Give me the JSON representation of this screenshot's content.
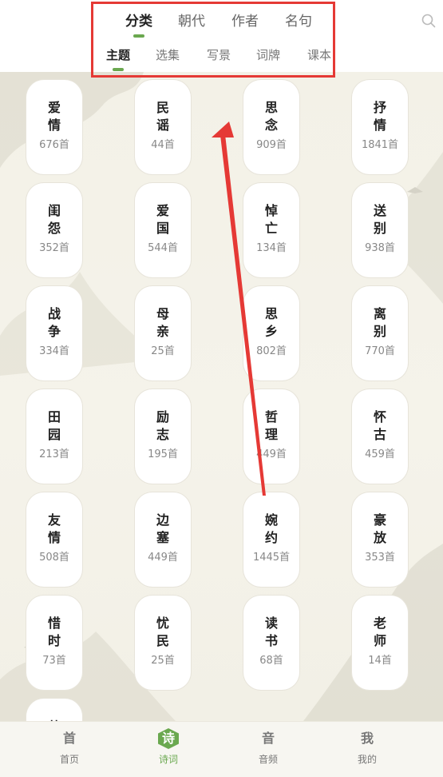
{
  "header": {
    "tabs": [
      {
        "label": "分类",
        "active": true
      },
      {
        "label": "朝代",
        "active": false
      },
      {
        "label": "作者",
        "active": false
      },
      {
        "label": "名句",
        "active": false
      }
    ],
    "subtabs": [
      {
        "label": "主题",
        "active": true
      },
      {
        "label": "选集",
        "active": false
      },
      {
        "label": "写景",
        "active": false
      },
      {
        "label": "词牌",
        "active": false
      },
      {
        "label": "课本",
        "active": false
      }
    ],
    "search_icon": "search-icon"
  },
  "topics": [
    {
      "c1": "爱",
      "c2": "情",
      "count": "676首"
    },
    {
      "c1": "民",
      "c2": "谣",
      "count": "44首"
    },
    {
      "c1": "思",
      "c2": "念",
      "count": "909首"
    },
    {
      "c1": "抒",
      "c2": "情",
      "count": "1841首"
    },
    {
      "c1": "闺",
      "c2": "怨",
      "count": "352首"
    },
    {
      "c1": "爱",
      "c2": "国",
      "count": "544首"
    },
    {
      "c1": "悼",
      "c2": "亡",
      "count": "134首"
    },
    {
      "c1": "送",
      "c2": "别",
      "count": "938首"
    },
    {
      "c1": "战",
      "c2": "争",
      "count": "334首"
    },
    {
      "c1": "母",
      "c2": "亲",
      "count": "25首"
    },
    {
      "c1": "思",
      "c2": "乡",
      "count": "802首"
    },
    {
      "c1": "离",
      "c2": "别",
      "count": "770首"
    },
    {
      "c1": "田",
      "c2": "园",
      "count": "213首"
    },
    {
      "c1": "励",
      "c2": "志",
      "count": "195首"
    },
    {
      "c1": "哲",
      "c2": "理",
      "count": "449首"
    },
    {
      "c1": "怀",
      "c2": "古",
      "count": "459首"
    },
    {
      "c1": "友",
      "c2": "情",
      "count": "508首"
    },
    {
      "c1": "边",
      "c2": "塞",
      "count": "449首"
    },
    {
      "c1": "婉",
      "c2": "约",
      "count": "1445首"
    },
    {
      "c1": "豪",
      "c2": "放",
      "count": "353首"
    },
    {
      "c1": "惜",
      "c2": "时",
      "count": "73首"
    },
    {
      "c1": "忧",
      "c2": "民",
      "count": "25首"
    },
    {
      "c1": "读",
      "c2": "书",
      "count": "68首"
    },
    {
      "c1": "老",
      "c2": "师",
      "count": "14首"
    },
    {
      "c1": "儿",
      "c2": "",
      "count": ""
    }
  ],
  "bottom_nav": [
    {
      "icon_char": "首",
      "label": "首页",
      "active": false
    },
    {
      "icon_char": "诗",
      "label": "诗词",
      "active": true
    },
    {
      "icon_char": "音",
      "label": "音频",
      "active": false
    },
    {
      "icon_char": "我",
      "label": "我的",
      "active": false
    }
  ],
  "colors": {
    "accent": "#6aa84f",
    "annotation": "#e53935"
  }
}
